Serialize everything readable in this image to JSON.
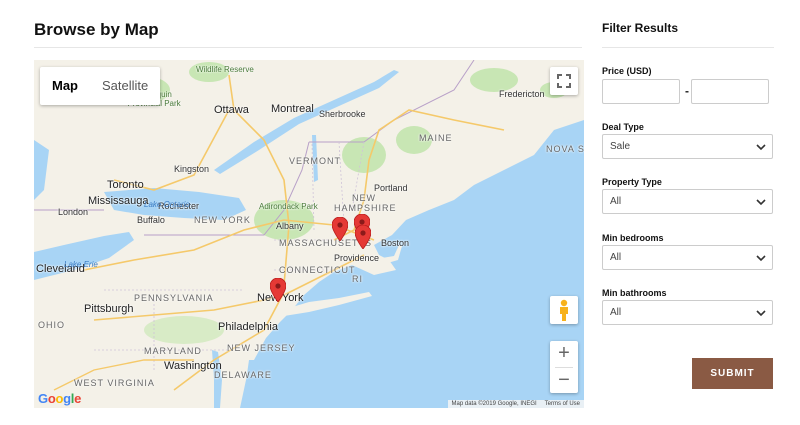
{
  "left": {
    "title": "Browse by Map"
  },
  "map": {
    "type_tabs": [
      {
        "label": "Map",
        "active": true
      },
      {
        "label": "Satellite",
        "active": false
      }
    ],
    "attribution": "Map data ©2019 Google, INEGI",
    "terms": "Terms of Use",
    "logo": "Google",
    "zoom_in": "+",
    "zoom_out": "−",
    "labels": {
      "cities": [
        "Ottawa",
        "Montreal",
        "Sherbrooke",
        "Toronto",
        "Mississauga",
        "Kingston",
        "Rochester",
        "London",
        "Buffalo",
        "Albany",
        "Boston",
        "Providence",
        "New York",
        "Cleveland",
        "Pittsburgh",
        "Philadelphia",
        "Washington",
        "Portland",
        "Fredericton",
        "Algonquin Provincial Park",
        "Wildlife Reserve",
        "Adirondack Park"
      ],
      "states": [
        "VERMONT",
        "MAINE",
        "NEW HAMPSHIRE",
        "NEW YORK",
        "MASSACHUSETTS",
        "CONNECTICUT",
        "PENNSYLVANIA",
        "NEW JERSEY",
        "MARYLAND",
        "DELAWARE",
        "OHIO",
        "RI",
        "NOVA SCO",
        "WEST VIRGINIA"
      ],
      "water": [
        "Lake Ontario",
        "Lake Erie"
      ]
    }
  },
  "filter": {
    "title": "Filter Results",
    "price_label": "Price (USD)",
    "price_min": "",
    "price_max": "",
    "dash": "-",
    "deal_type_label": "Deal Type",
    "deal_type_value": "Sale",
    "property_type_label": "Property Type",
    "property_type_value": "All",
    "min_bedrooms_label": "Min bedrooms",
    "min_bedrooms_value": "All",
    "min_bathrooms_label": "Min bathrooms",
    "min_bathrooms_value": "All",
    "submit_label": "SUBMIT"
  },
  "colors": {
    "submit": "#8a5a44",
    "water": "#a8d4f5",
    "land": "#f4f1e8",
    "park": "#c8e6b4",
    "marker": "#e53935"
  }
}
